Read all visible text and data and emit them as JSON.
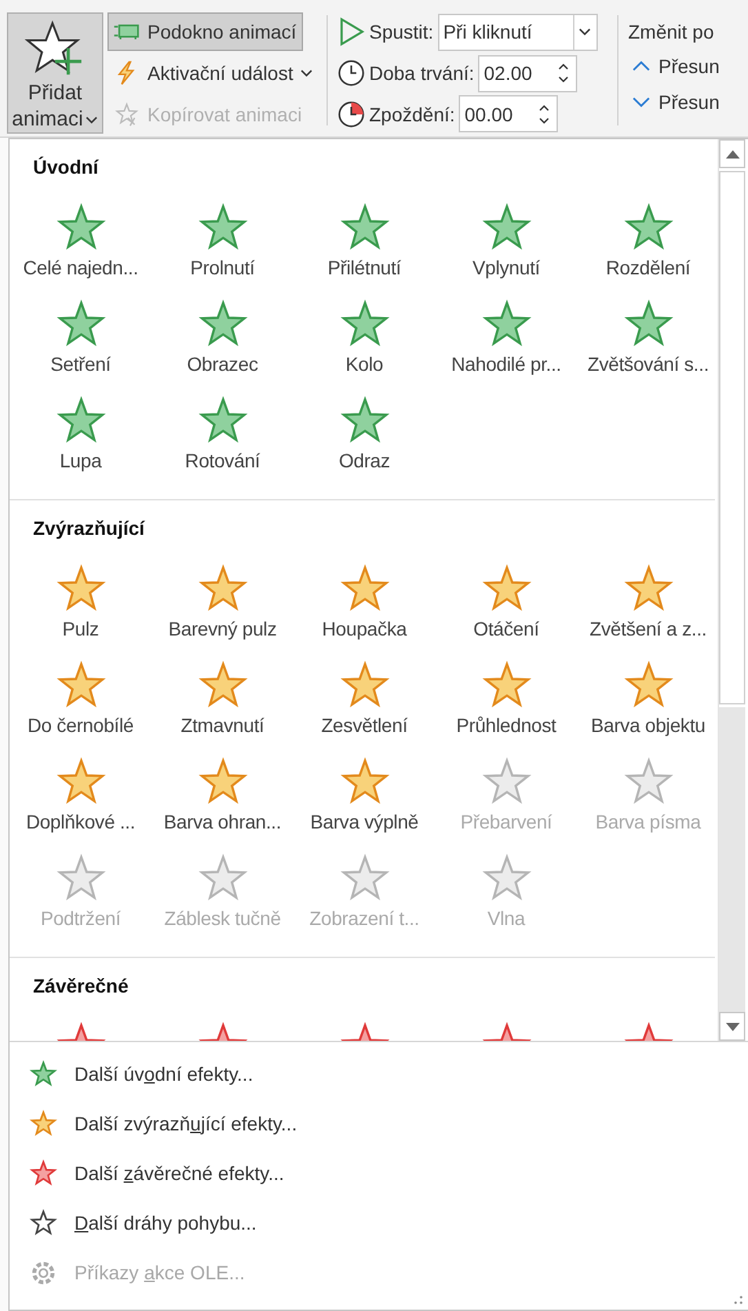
{
  "ribbon": {
    "add_button": {
      "line1": "Přidat",
      "line2": "animaci",
      "pressed": true
    },
    "pane_button": {
      "label": "Podokno animací",
      "selected": true
    },
    "trigger_button": {
      "label": "Aktivační událost",
      "disabled": false
    },
    "copy_button": {
      "label": "Kopírovat animaci",
      "disabled": true
    },
    "start": {
      "label": "Spustit:",
      "value": "Při kliknutí"
    },
    "duration": {
      "label": "Doba trvání:",
      "value": "02.00"
    },
    "delay": {
      "label": "Zpoždění:",
      "value": "00.00"
    },
    "reorder": {
      "title": "Změnit po",
      "move_earlier": "Přesun",
      "move_later": "Přesun"
    }
  },
  "gallery": {
    "sections": [
      {
        "title": "Úvodní",
        "kind": "entrance",
        "items": [
          {
            "label": "Celé najedn...",
            "disabled": false
          },
          {
            "label": "Prolnutí",
            "disabled": false
          },
          {
            "label": "Přilétnutí",
            "disabled": false
          },
          {
            "label": "Vplynutí",
            "disabled": false
          },
          {
            "label": "Rozdělení",
            "disabled": false
          },
          {
            "label": "Setření",
            "disabled": false
          },
          {
            "label": "Obrazec",
            "disabled": false
          },
          {
            "label": "Kolo",
            "disabled": false
          },
          {
            "label": "Nahodilé pr...",
            "disabled": false
          },
          {
            "label": "Zvětšování s...",
            "disabled": false
          },
          {
            "label": "Lupa",
            "disabled": false
          },
          {
            "label": "Rotování",
            "disabled": false
          },
          {
            "label": "Odraz",
            "disabled": false
          }
        ]
      },
      {
        "title": "Zvýrazňující",
        "kind": "emphasis",
        "items": [
          {
            "label": "Pulz",
            "disabled": false
          },
          {
            "label": "Barevný pulz",
            "disabled": false
          },
          {
            "label": "Houpačka",
            "disabled": false
          },
          {
            "label": "Otáčení",
            "disabled": false
          },
          {
            "label": "Zvětšení a z...",
            "disabled": false
          },
          {
            "label": "Do černobílé",
            "disabled": false
          },
          {
            "label": "Ztmavnutí",
            "disabled": false
          },
          {
            "label": "Zesvětlení",
            "disabled": false
          },
          {
            "label": "Průhlednost",
            "disabled": false
          },
          {
            "label": "Barva objektu",
            "disabled": false
          },
          {
            "label": "Doplňkové ...",
            "disabled": false
          },
          {
            "label": "Barva ohran...",
            "disabled": false
          },
          {
            "label": "Barva výplně",
            "disabled": false
          },
          {
            "label": "Přebarvení",
            "disabled": true
          },
          {
            "label": "Barva písma",
            "disabled": true
          },
          {
            "label": "Podtržení",
            "disabled": true
          },
          {
            "label": "Záblesk tučně",
            "disabled": true
          },
          {
            "label": "Zobrazení t...",
            "disabled": true
          },
          {
            "label": "Vlna",
            "disabled": true
          }
        ]
      },
      {
        "title": "Závěrečné",
        "kind": "exit",
        "items": [
          {
            "disabled": false
          },
          {
            "disabled": false
          },
          {
            "disabled": false
          },
          {
            "disabled": false
          },
          {
            "disabled": false
          }
        ]
      }
    ]
  },
  "menu": [
    {
      "kind": "entrance",
      "before": "Další úv",
      "key": "o",
      "after": "dní efekty...",
      "disabled": false
    },
    {
      "kind": "emphasis",
      "before": "Další zvýrazň",
      "key": "u",
      "after": "jící efekty...",
      "disabled": false
    },
    {
      "kind": "exit",
      "before": "Další ",
      "key": "z",
      "after": "ávěrečné efekty...",
      "disabled": false
    },
    {
      "kind": "motion",
      "key": "D",
      "after": "alší dráhy pohybu...",
      "disabled": false
    },
    {
      "kind": "ole",
      "before": "Příkazy ",
      "key": "a",
      "after": "kce OLE...",
      "disabled": true
    }
  ]
}
